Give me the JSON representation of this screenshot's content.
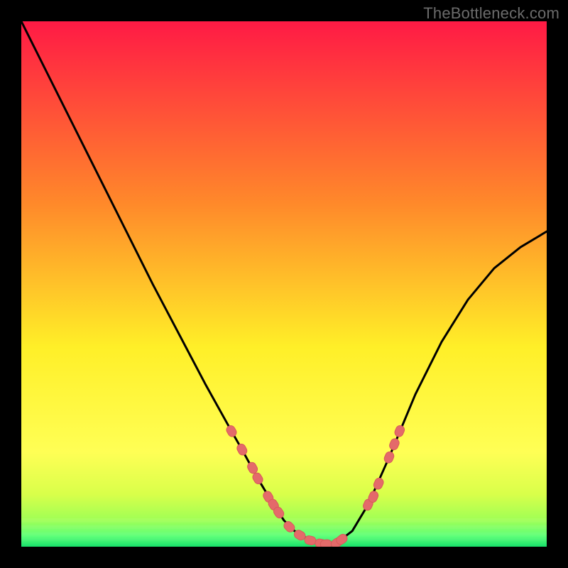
{
  "watermark": "TheBottleneck.com",
  "colors": {
    "background": "#000000",
    "gradient_top": "#ff1a45",
    "gradient_upper_mid": "#ff8a2a",
    "gradient_mid": "#ffef28",
    "gradient_lower": "#d9ff4a",
    "gradient_bottom_band": "#5eff7a",
    "gradient_bottom_edge": "#18e06a",
    "curve_stroke": "#000000",
    "marker_fill": "#e46a6a",
    "marker_stroke": "#d85a5a"
  },
  "chart_data": {
    "type": "line",
    "title": "",
    "xlabel": "",
    "ylabel": "",
    "xlim": [
      0,
      100
    ],
    "ylim": [
      0,
      100
    ],
    "grid": false,
    "legend": false,
    "series": [
      {
        "name": "bottleneck-curve",
        "x": [
          0,
          5,
          10,
          15,
          20,
          25,
          30,
          35,
          40,
          42,
          45,
          48,
          50,
          52,
          55,
          58,
          60,
          63,
          66,
          70,
          75,
          80,
          85,
          90,
          95,
          100
        ],
        "values": [
          100,
          90,
          80,
          70,
          60,
          50,
          40.5,
          31,
          22,
          18.5,
          13,
          8,
          5,
          3,
          1.2,
          0.5,
          0.7,
          3,
          8,
          17,
          29,
          39,
          47,
          53,
          57,
          60
        ]
      }
    ],
    "markers": [
      {
        "name": "left-arm-marker-1",
        "x": 40,
        "y": 22
      },
      {
        "name": "left-arm-marker-2",
        "x": 42,
        "y": 18.5
      },
      {
        "name": "left-arm-marker-3",
        "x": 44,
        "y": 15
      },
      {
        "name": "left-arm-marker-4",
        "x": 45,
        "y": 13
      },
      {
        "name": "left-arm-marker-5",
        "x": 47,
        "y": 9.5
      },
      {
        "name": "left-arm-marker-6",
        "x": 48,
        "y": 8
      },
      {
        "name": "left-arm-marker-7",
        "x": 49,
        "y": 6.5
      },
      {
        "name": "bottom-marker-1",
        "x": 51,
        "y": 3.8
      },
      {
        "name": "bottom-marker-2",
        "x": 53,
        "y": 2.2
      },
      {
        "name": "bottom-marker-3",
        "x": 55,
        "y": 1.2
      },
      {
        "name": "bottom-marker-4",
        "x": 57,
        "y": 0.6
      },
      {
        "name": "bottom-marker-5",
        "x": 58,
        "y": 0.5
      },
      {
        "name": "bottom-marker-6",
        "x": 60,
        "y": 0.7
      },
      {
        "name": "bottom-marker-7",
        "x": 61,
        "y": 1.4
      },
      {
        "name": "right-arm-marker-1",
        "x": 66,
        "y": 8
      },
      {
        "name": "right-arm-marker-2",
        "x": 67,
        "y": 9.5
      },
      {
        "name": "right-arm-marker-3",
        "x": 68,
        "y": 12
      },
      {
        "name": "right-arm-marker-4",
        "x": 70,
        "y": 17
      },
      {
        "name": "right-arm-marker-5",
        "x": 71,
        "y": 19.5
      },
      {
        "name": "right-arm-marker-6",
        "x": 72,
        "y": 22
      }
    ]
  }
}
